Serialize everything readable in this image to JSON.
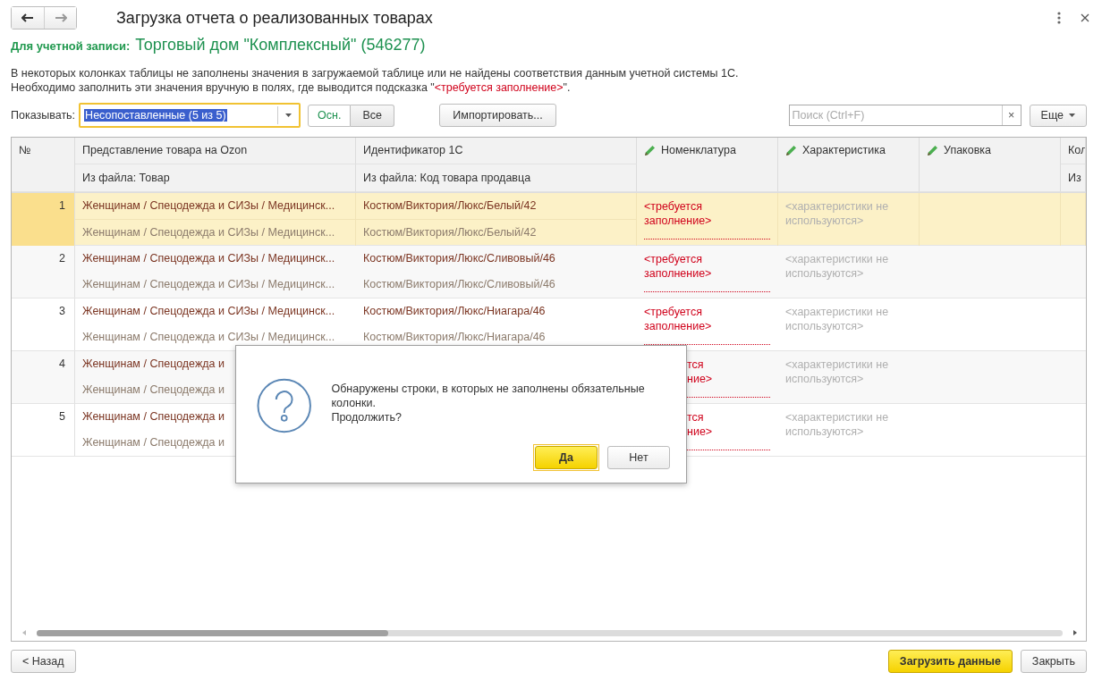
{
  "window": {
    "title": "Загрузка отчета о реализованных товарах"
  },
  "account": {
    "label": "Для учетной записи:",
    "name": "Торговый дом \"Комплексный\" (546277)"
  },
  "notice": {
    "line1": "В некоторых колонках таблицы не заполнены значения в загружаемой таблице или не найдены соответствия данным учетной системы 1С.",
    "line2_start": "Необходимо заполнить эти значения вручную в полях, где выводится подсказка \"",
    "line2_highlight": "<требуется заполнение>",
    "line2_end": "\"."
  },
  "filter": {
    "label": "Показывать:",
    "value": "Несопоставленные (5 из 5)",
    "toggle": [
      {
        "label": "Осн.",
        "selected": true
      },
      {
        "label": "Все",
        "selected": false
      }
    ]
  },
  "import_button": "Импортировать...",
  "search": {
    "placeholder": "Поиск (Ctrl+F)",
    "clear": "×"
  },
  "more_button": "Еще",
  "table": {
    "columns": [
      {
        "title": "№",
        "editable": false
      },
      {
        "title": "Представление товара на Ozon",
        "subtitle": "Из файла: Товар",
        "editable": false
      },
      {
        "title": "Идентификатор 1С",
        "subtitle": "Из файла: Код товара продавца",
        "editable": false
      },
      {
        "title": "Номенклатура",
        "editable": true
      },
      {
        "title": "Характеристика",
        "editable": true
      },
      {
        "title": "Упаковка",
        "editable": true
      },
      {
        "title": "Кол",
        "subtitle": "Из",
        "editable": false
      }
    ],
    "rows": [
      {
        "kind": "full",
        "number": "1",
        "selected": true,
        "product": [
          "Женщинам / Спецодежда и СИЗы / Медицинск...",
          "Женщинам / Спецодежда и СИЗы / Медицинск..."
        ],
        "id": [
          "Костюм/Виктория/Люкс/Белый/42",
          "Костюм/Виктория/Люкс/Белый/42"
        ],
        "nomenclature": "<требуется заполнение>",
        "characteristic": "<характеристики не используются>"
      },
      {
        "kind": "full",
        "number": "2",
        "selected": false,
        "product": [
          "Женщинам / Спецодежда и СИЗы / Медицинск...",
          "Женщинам / Спецодежда и СИЗы / Медицинск..."
        ],
        "id": [
          "Костюм/Виктория/Люкс/Сливовый/46",
          "Костюм/Виктория/Люкс/Сливовый/46"
        ],
        "nomenclature": "<требуется заполнение>",
        "characteristic": "<характеристики не используются>"
      },
      {
        "kind": "full",
        "number": "3",
        "selected": false,
        "product": [
          "Женщинам / Спецодежда и СИЗы / Медицинск...",
          "Женщинам / Спецодежда и СИЗы / Медицинск..."
        ],
        "id": [
          "Костюм/Виктория/Люкс/Ниагара/46",
          "Костюм/Виктория/Люкс/Ниагара/46"
        ],
        "nomenclature": "<требуется заполнение>",
        "characteristic": "<характеристики не используются>"
      },
      {
        "kind": "covered",
        "number": "4",
        "selected": false,
        "product": [
          "Женщинам / Спецодежда и",
          "Женщинам / Спецодежда и"
        ],
        "nomenclature": "тся\nние>",
        "characteristic": "<характеристики не используются>"
      },
      {
        "kind": "covered",
        "number": "5",
        "selected": false,
        "product": [
          "Женщинам / Спецодежда и",
          "Женщинам / Спецодежда и"
        ],
        "nomenclature": "тся\nние>",
        "characteristic": "<характеристики не используются>"
      }
    ]
  },
  "dialog": {
    "message": "Обнаружены строки, в которых не заполнены обязательные колонки.",
    "question": "Продолжить?",
    "buttons": [
      {
        "label": "Да",
        "kind": "default"
      },
      {
        "label": "Нет",
        "kind": "normal"
      }
    ]
  },
  "footer": {
    "back_button": "< Назад",
    "load_button": "Загрузить данные",
    "close_button": "Закрыть"
  }
}
